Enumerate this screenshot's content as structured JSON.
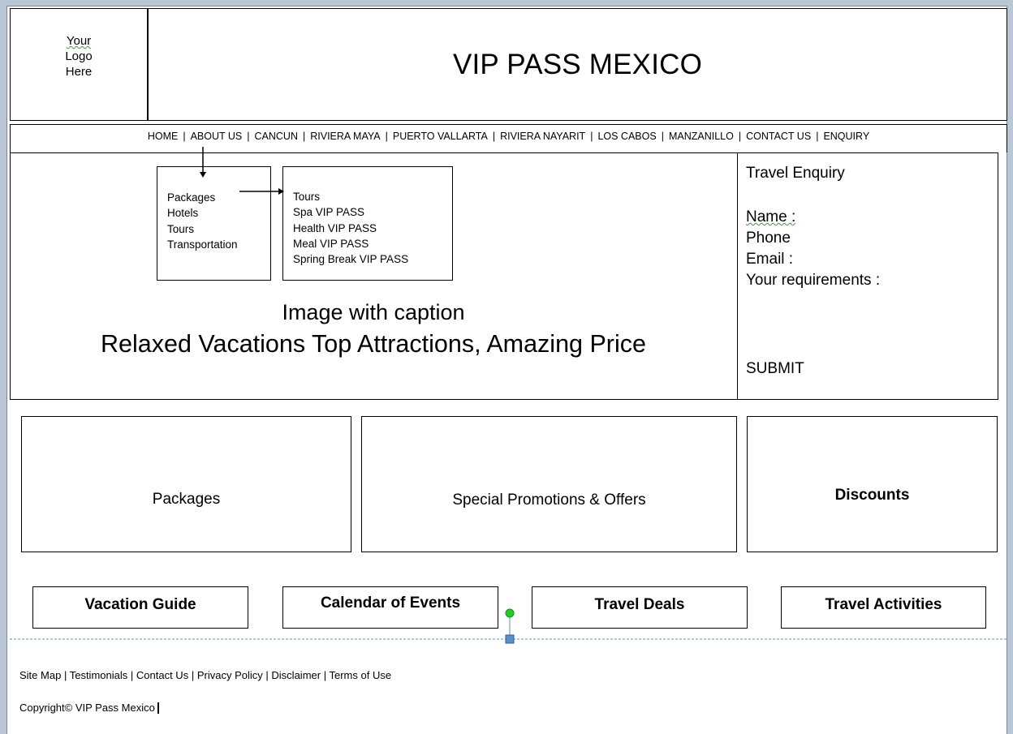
{
  "header": {
    "logo_lines": [
      "Your",
      "Logo",
      "Here"
    ],
    "title": "VIP PASS MEXICO"
  },
  "nav": {
    "items": [
      "HOME",
      "ABOUT US",
      "CANCUN",
      "RIVIERA MAYA",
      "PUERTO VALLARTA",
      "RIVIERA NAYARIT",
      "LOS CABOS",
      "MANZANILLO",
      "CONTACT US",
      "ENQUIRY"
    ],
    "separator": "|"
  },
  "cancun_menu": {
    "items": [
      "Packages",
      "Hotels",
      "Tours",
      "Transportation"
    ]
  },
  "packages_submenu": {
    "items": [
      "Tours",
      "Spa VIP PASS",
      "Health VIP PASS",
      "Meal VIP PASS",
      "Spring Break VIP PASS"
    ]
  },
  "hero": {
    "caption_title": "Image with caption",
    "caption_text": "Relaxed Vacations Top Attractions, Amazing Price"
  },
  "enquiry": {
    "title": "Travel Enquiry",
    "name_label": "Name :",
    "phone_label": "Phone",
    "email_label": "Email :",
    "requirements_label": "Your requirements :",
    "submit_label": "SUBMIT"
  },
  "features": [
    "Packages",
    "Special Promotions & Offers",
    "Discounts"
  ],
  "buttons": [
    "Vacation Guide",
    "Calendar of Events",
    "Travel Deals",
    "Travel Activities"
  ],
  "footer": {
    "links": [
      "Site Map",
      "Testimonials",
      "Contact Us",
      "Privacy Policy",
      "Disclaimer",
      "Terms of Use"
    ],
    "separator": "|",
    "copyright": "Copyright© VIP Pass Mexico"
  },
  "colors": {
    "window_frame": "#b9c6d6",
    "guide_line": "#5b8ec9",
    "handle_green": "#22cc22",
    "handle_blue": "#5b8ec9"
  }
}
